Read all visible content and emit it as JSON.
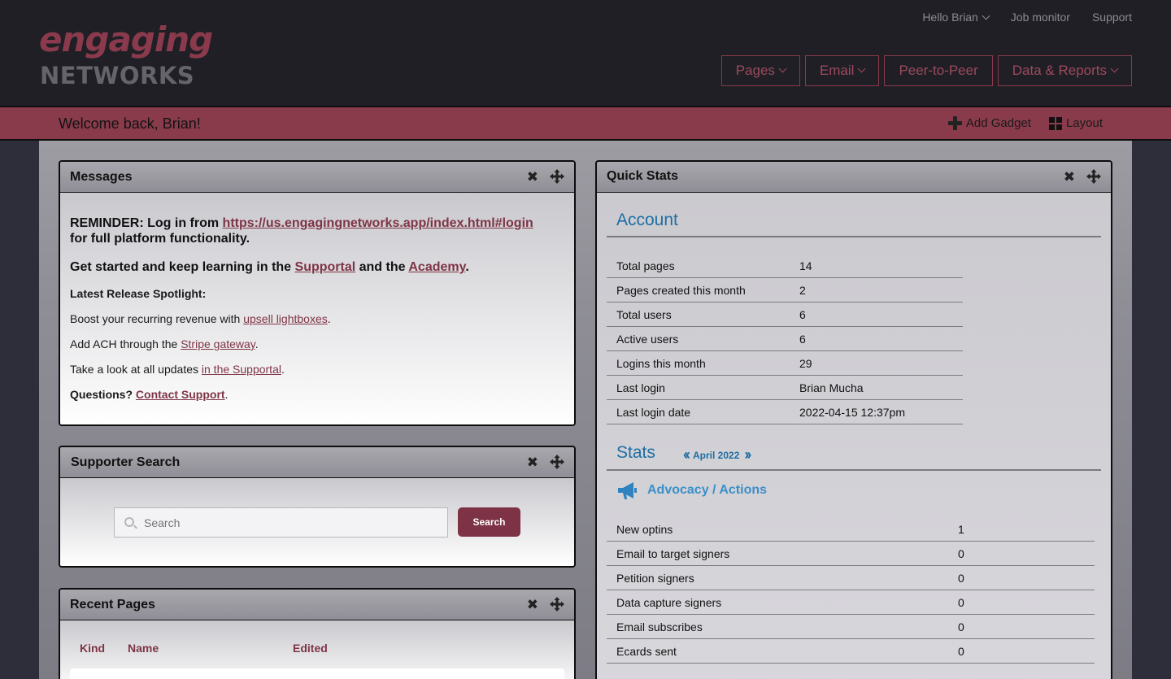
{
  "header": {
    "logo_top": "engaging",
    "logo_bottom": "NETWORKS",
    "top_links": {
      "hello": "Hello Brian",
      "job_monitor": "Job monitor",
      "support": "Support"
    },
    "nav": {
      "pages": "Pages",
      "email": "Email",
      "p2p": "Peer-to-Peer",
      "data": "Data & Reports"
    }
  },
  "welcome": {
    "text": "Welcome back, Brian!",
    "add_gadget": "Add Gadget",
    "layout": "Layout"
  },
  "messages": {
    "title": "Messages",
    "reminder_prefix": "REMINDER: Log in from ",
    "reminder_link": "https://us.engagingnetworks.app/index.html#login",
    "reminder_suffix": "for full platform functionality.",
    "learn_prefix": "Get started and keep learning in the ",
    "learn_link1": "Supportal",
    "learn_mid": " and the ",
    "learn_link2": "Academy",
    "learn_suffix": ".",
    "spotlight": "Latest Release Spotlight:",
    "l1_prefix": "Boost your recurring revenue with ",
    "l1_link": "upsell lightboxes",
    "l2_prefix": "Add ACH through the ",
    "l2_link": "Stripe gateway",
    "l3_prefix": "Take a look at all updates ",
    "l3_link": "in the Supportal",
    "q_prefix": "Questions? ",
    "q_link": "Contact Support",
    "dot": "."
  },
  "search": {
    "title": "Supporter Search",
    "placeholder": "Search",
    "button": "Search"
  },
  "recent": {
    "title": "Recent Pages",
    "col_kind": "Kind",
    "col_name": "Name",
    "col_edited": "Edited"
  },
  "quick_stats": {
    "title": "Quick Stats",
    "account_title": "Account",
    "account": [
      {
        "label": "Total pages",
        "value": "14"
      },
      {
        "label": "Pages created this month",
        "value": "2"
      },
      {
        "label": "Total users",
        "value": "6"
      },
      {
        "label": "Active users",
        "value": "6"
      },
      {
        "label": "Logins this month",
        "value": "29"
      },
      {
        "label": "Last login",
        "value": "Brian Mucha"
      },
      {
        "label": "Last login date",
        "value": "2022-04-15 12:37pm"
      }
    ],
    "stats_title": "Stats",
    "month": "April 2022",
    "prev": "‹‹",
    "next": "››",
    "advocacy_title": "Advocacy / Actions",
    "advocacy": [
      {
        "label": "New optins",
        "value": "1"
      },
      {
        "label": "Email to target signers",
        "value": "0"
      },
      {
        "label": "Petition signers",
        "value": "0"
      },
      {
        "label": "Data capture signers",
        "value": "0"
      },
      {
        "label": "Email subscribes",
        "value": "0"
      },
      {
        "label": "Ecards sent",
        "value": "0"
      }
    ]
  }
}
